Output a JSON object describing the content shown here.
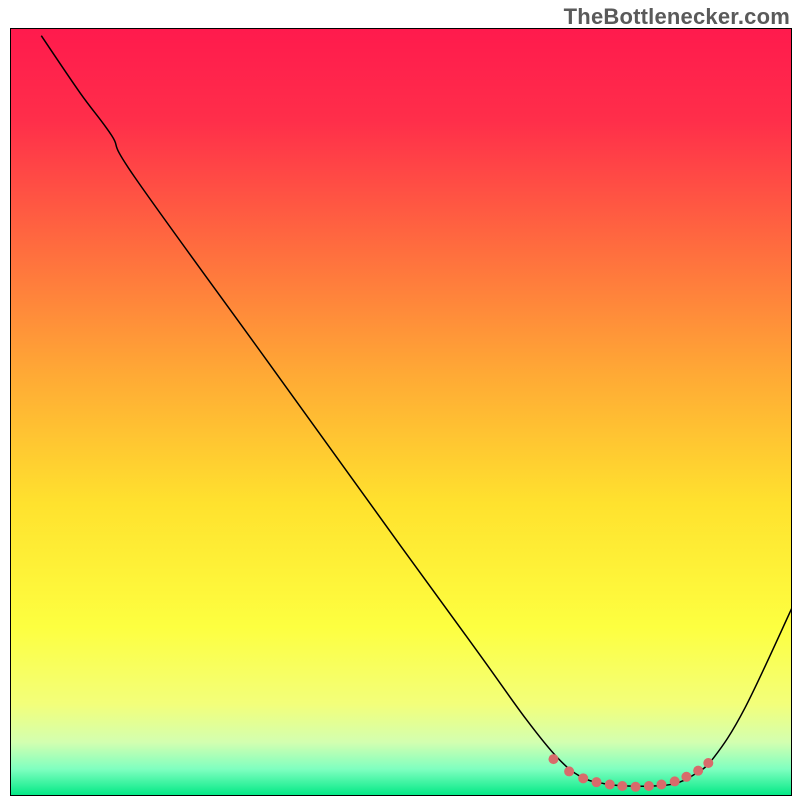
{
  "watermark": "TheBottlenecker.com",
  "chart_data": {
    "type": "line",
    "title": "",
    "xlabel": "",
    "ylabel": "",
    "xlim": [
      0,
      100
    ],
    "ylim": [
      0,
      100
    ],
    "grid": false,
    "legend": false,
    "background_gradient": {
      "stops": [
        {
          "offset": 0.0,
          "color": "#ff1a4d"
        },
        {
          "offset": 0.12,
          "color": "#ff2e4a"
        },
        {
          "offset": 0.28,
          "color": "#ff6a3f"
        },
        {
          "offset": 0.45,
          "color": "#ffa935"
        },
        {
          "offset": 0.62,
          "color": "#ffe22e"
        },
        {
          "offset": 0.78,
          "color": "#fdff40"
        },
        {
          "offset": 0.88,
          "color": "#f3ff7a"
        },
        {
          "offset": 0.93,
          "color": "#d3ffb0"
        },
        {
          "offset": 0.965,
          "color": "#7fffc0"
        },
        {
          "offset": 1.0,
          "color": "#00e884"
        }
      ]
    },
    "series": [
      {
        "name": "bottleneck-curve",
        "stroke": "#000000",
        "stroke_width": 1.5,
        "points": [
          {
            "x": 4.0,
            "y": 99.0
          },
          {
            "x": 9.0,
            "y": 91.5
          },
          {
            "x": 13.0,
            "y": 86.0
          },
          {
            "x": 16.0,
            "y": 80.5
          },
          {
            "x": 33.0,
            "y": 56.5
          },
          {
            "x": 50.0,
            "y": 32.5
          },
          {
            "x": 60.0,
            "y": 18.5
          },
          {
            "x": 66.0,
            "y": 10.0
          },
          {
            "x": 70.0,
            "y": 5.0
          },
          {
            "x": 73.0,
            "y": 2.5
          },
          {
            "x": 76.0,
            "y": 1.6
          },
          {
            "x": 79.0,
            "y": 1.3
          },
          {
            "x": 82.0,
            "y": 1.3
          },
          {
            "x": 85.0,
            "y": 1.6
          },
          {
            "x": 87.5,
            "y": 2.8
          },
          {
            "x": 90.0,
            "y": 5.0
          },
          {
            "x": 94.0,
            "y": 11.5
          },
          {
            "x": 100.0,
            "y": 24.5
          }
        ]
      },
      {
        "name": "highlight-dots",
        "stroke": "#d86b6b",
        "dot_radius": 5,
        "points": [
          {
            "x": 69.5,
            "y": 4.8
          },
          {
            "x": 71.5,
            "y": 3.2
          },
          {
            "x": 73.3,
            "y": 2.3
          },
          {
            "x": 75.0,
            "y": 1.8
          },
          {
            "x": 76.7,
            "y": 1.5
          },
          {
            "x": 78.3,
            "y": 1.3
          },
          {
            "x": 80.0,
            "y": 1.2
          },
          {
            "x": 81.7,
            "y": 1.3
          },
          {
            "x": 83.3,
            "y": 1.5
          },
          {
            "x": 85.0,
            "y": 1.9
          },
          {
            "x": 86.5,
            "y": 2.5
          },
          {
            "x": 88.0,
            "y": 3.3
          },
          {
            "x": 89.3,
            "y": 4.3
          }
        ]
      }
    ]
  }
}
